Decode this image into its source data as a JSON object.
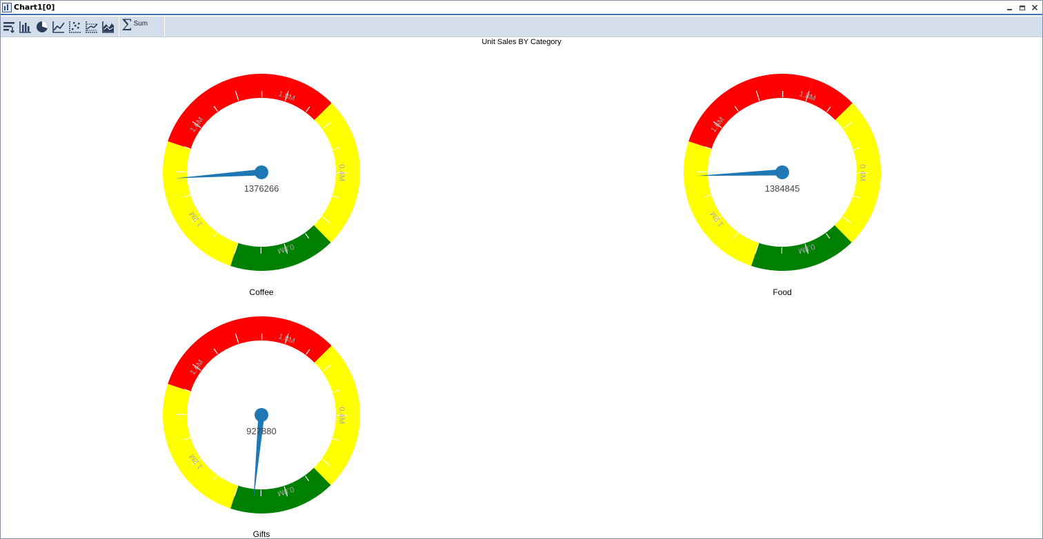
{
  "window": {
    "title": "Chart1[0]"
  },
  "toolbar": {
    "buttons": [
      {
        "name": "sort-button",
        "icon": "sort-icon"
      },
      {
        "name": "bar-chart-button",
        "icon": "bar-chart-icon"
      },
      {
        "name": "pie-chart-button",
        "icon": "pie-chart-icon"
      },
      {
        "name": "line-chart-button",
        "icon": "line-chart-icon"
      },
      {
        "name": "scatter-chart-button",
        "icon": "scatter-chart-icon"
      },
      {
        "name": "band-chart-button",
        "icon": "band-chart-icon"
      },
      {
        "name": "area-chart-button",
        "icon": "area-chart-icon"
      }
    ],
    "sum_label": "Sum",
    "sum_icon": "sigma-icon"
  },
  "chart_data": {
    "type": "gauge",
    "title": "Unit Sales BY Category",
    "scale": {
      "min": 0,
      "max": 2000000
    },
    "band_colors": {
      "green": "#008000",
      "yellow": "#ffff00",
      "red": "#ff0000"
    },
    "band_ranges": [
      {
        "from": 0,
        "to": 150000,
        "color": "red"
      },
      {
        "from": 150000,
        "to": 650000,
        "color": "yellow"
      },
      {
        "from": 650000,
        "to": 1000000,
        "color": "green"
      },
      {
        "from": 1000000,
        "to": 1500000,
        "color": "yellow"
      },
      {
        "from": 1500000,
        "to": 2000000,
        "color": "red"
      }
    ],
    "tick_labels": [
      {
        "value": 400000,
        "text": "0.4M"
      },
      {
        "value": 800000,
        "text": "0.8M"
      },
      {
        "value": 1200000,
        "text": "1.2M"
      },
      {
        "value": 1600000,
        "text": "1.6M"
      },
      {
        "value": 2000000,
        "text": "1.8M"
      }
    ],
    "needle_color": "#1f77b4",
    "gauges": [
      {
        "category": "Coffee",
        "value": 1376266,
        "value_text": "1376266"
      },
      {
        "category": "Food",
        "value": 1384845,
        "value_text": "1384845"
      },
      {
        "category": "Gifts",
        "value": 927880,
        "value_text": "927880"
      }
    ]
  }
}
